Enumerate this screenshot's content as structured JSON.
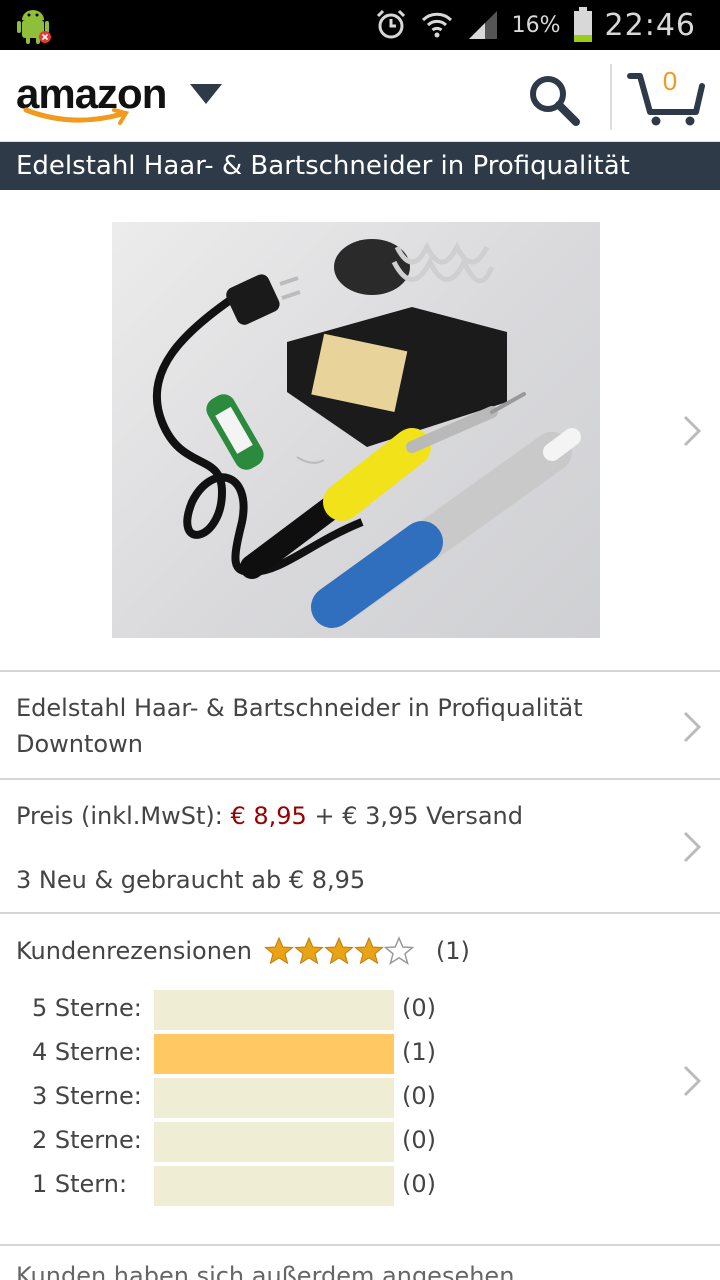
{
  "status_bar": {
    "battery": "16%",
    "time": "22:46",
    "icons": [
      "android-debug-icon",
      "alarm-icon",
      "wifi-icon",
      "signal-icon",
      "battery-icon"
    ]
  },
  "header": {
    "logo_text": "amazon",
    "cart_count": "0",
    "icons": [
      "search-icon",
      "cart-icon",
      "caret-down-icon"
    ],
    "accent_color": "#f09a1e"
  },
  "title_bar": {
    "title": "Edelstahl Haar- & Bartschneider in Profiqualität"
  },
  "product": {
    "name": "Edelstahl Haar- & Bartschneider in Profiqualität Downtown",
    "price_label": "Preis (inkl.MwSt):",
    "price": "€ 8,95",
    "shipping": "+ € 3,95 Versand",
    "used_new": "3 Neu & gebraucht ab € 8,95"
  },
  "reviews": {
    "label": "Kundenrezensionen",
    "rating_stars": 4,
    "max_stars": 5,
    "count": "(1)",
    "distribution": [
      {
        "label": "5 Sterne:",
        "count": "(0)",
        "fraction": 0
      },
      {
        "label": "4 Sterne:",
        "count": "(1)",
        "fraction": 1
      },
      {
        "label": "3 Sterne:",
        "count": "(0)",
        "fraction": 0
      },
      {
        "label": "2 Sterne:",
        "count": "(0)",
        "fraction": 0
      },
      {
        "label": "1 Stern:",
        "count": "(0)",
        "fraction": 0
      }
    ]
  },
  "footer_cut_text": "Kunden haben sich außerdem angesehen"
}
